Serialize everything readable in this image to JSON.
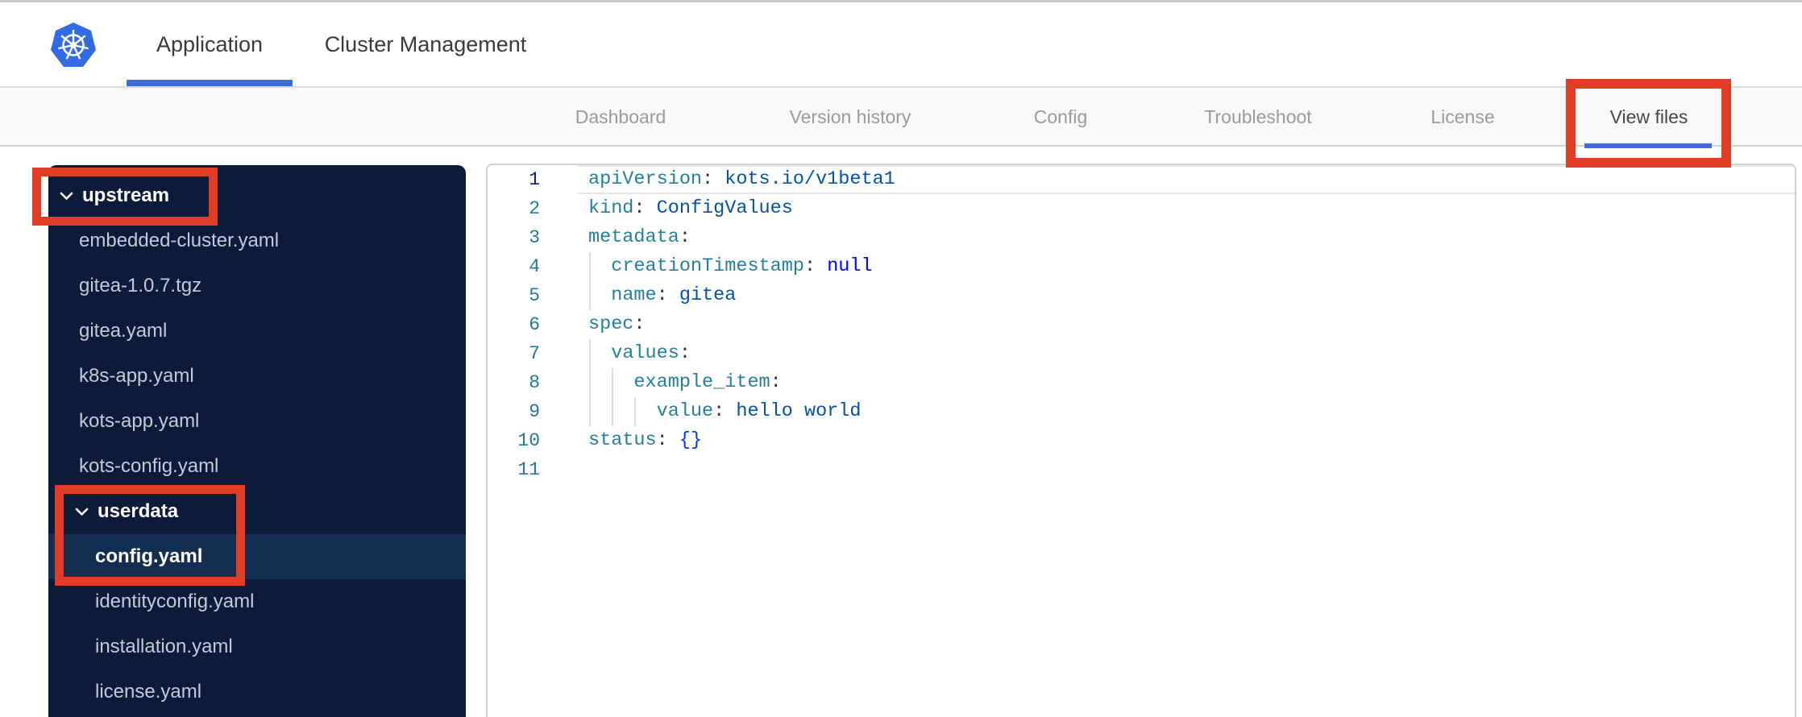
{
  "topbar": {
    "tabs": [
      {
        "label": "Application",
        "active": true
      },
      {
        "label": "Cluster Management",
        "active": false
      }
    ]
  },
  "subnav": {
    "tabs": [
      {
        "label": "Dashboard",
        "active": false
      },
      {
        "label": "Version history",
        "active": false
      },
      {
        "label": "Config",
        "active": false
      },
      {
        "label": "Troubleshoot",
        "active": false
      },
      {
        "label": "License",
        "active": false
      },
      {
        "label": "View files",
        "active": true
      }
    ]
  },
  "sidebar": {
    "items": [
      {
        "label": "upstream",
        "type": "folder",
        "level": 0,
        "expanded": true
      },
      {
        "label": "embedded-cluster.yaml",
        "type": "file",
        "level": 1
      },
      {
        "label": "gitea-1.0.7.tgz",
        "type": "file",
        "level": 1
      },
      {
        "label": "gitea.yaml",
        "type": "file",
        "level": 1
      },
      {
        "label": "k8s-app.yaml",
        "type": "file",
        "level": 1
      },
      {
        "label": "kots-app.yaml",
        "type": "file",
        "level": 1
      },
      {
        "label": "kots-config.yaml",
        "type": "file",
        "level": 1
      },
      {
        "label": "userdata",
        "type": "folder",
        "level": 1,
        "expanded": true
      },
      {
        "label": "config.yaml",
        "type": "file",
        "level": 2,
        "selected": true
      },
      {
        "label": "identityconfig.yaml",
        "type": "file",
        "level": 2
      },
      {
        "label": "installation.yaml",
        "type": "file",
        "level": 2
      },
      {
        "label": "license.yaml",
        "type": "file",
        "level": 2
      }
    ]
  },
  "editor": {
    "language": "yaml",
    "lines": [
      {
        "num": "1",
        "current": true,
        "segments": [
          {
            "t": "apiVersion",
            "c": "key"
          },
          {
            "t": ": ",
            "c": "punct"
          },
          {
            "t": "kots.io/v1beta1",
            "c": "str"
          }
        ]
      },
      {
        "num": "2",
        "segments": [
          {
            "t": "kind",
            "c": "key"
          },
          {
            "t": ": ",
            "c": "punct"
          },
          {
            "t": "ConfigValues",
            "c": "str"
          }
        ]
      },
      {
        "num": "3",
        "segments": [
          {
            "t": "metadata",
            "c": "key"
          },
          {
            "t": ":",
            "c": "punct"
          }
        ]
      },
      {
        "num": "4",
        "segments": [
          {
            "t": "  ",
            "c": "plain"
          },
          {
            "t": "creationTimestamp",
            "c": "key"
          },
          {
            "t": ": ",
            "c": "punct"
          },
          {
            "t": "null",
            "c": "kw"
          }
        ]
      },
      {
        "num": "5",
        "segments": [
          {
            "t": "  ",
            "c": "plain"
          },
          {
            "t": "name",
            "c": "key"
          },
          {
            "t": ": ",
            "c": "punct"
          },
          {
            "t": "gitea",
            "c": "str"
          }
        ]
      },
      {
        "num": "6",
        "segments": [
          {
            "t": "spec",
            "c": "key"
          },
          {
            "t": ":",
            "c": "punct"
          }
        ]
      },
      {
        "num": "7",
        "segments": [
          {
            "t": "  ",
            "c": "plain"
          },
          {
            "t": "values",
            "c": "key"
          },
          {
            "t": ":",
            "c": "punct"
          }
        ]
      },
      {
        "num": "8",
        "segments": [
          {
            "t": "    ",
            "c": "plain"
          },
          {
            "t": "example_item",
            "c": "key"
          },
          {
            "t": ":",
            "c": "punct"
          }
        ]
      },
      {
        "num": "9",
        "segments": [
          {
            "t": "      ",
            "c": "plain"
          },
          {
            "t": "value",
            "c": "key"
          },
          {
            "t": ": ",
            "c": "punct"
          },
          {
            "t": "hello world",
            "c": "str"
          }
        ]
      },
      {
        "num": "10",
        "segments": [
          {
            "t": "status",
            "c": "key"
          },
          {
            "t": ": ",
            "c": "punct"
          },
          {
            "t": "{}",
            "c": "bracket"
          }
        ]
      },
      {
        "num": "11",
        "segments": []
      }
    ]
  },
  "icons": {
    "logo": "kubernetes-helm-wheel",
    "folder_marker": "chevron-down"
  },
  "colors": {
    "annotation_red": "#e13c26",
    "accent_blue": "#3b6fd6",
    "k8s_blue": "#326ce5",
    "sidebar_bg": "#0d1b3a",
    "sidebar_selected_bg": "#142e52",
    "code_key": "#267f99",
    "code_string": "#0451a5",
    "code_keyword": "#0000ff",
    "line_number": "#237893",
    "line_number_active": "#0b216f"
  },
  "annotations": [
    {
      "target": "upstream-folder"
    },
    {
      "target": "userdata-config-yaml"
    },
    {
      "target": "view-files-tab"
    }
  ]
}
